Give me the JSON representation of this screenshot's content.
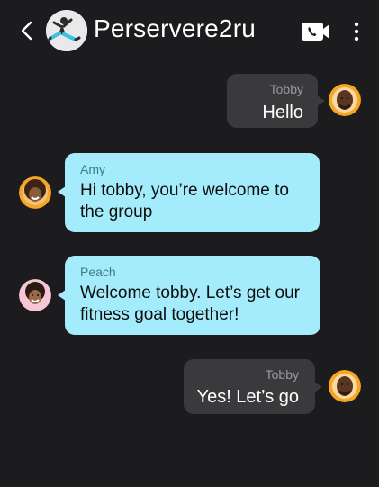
{
  "header": {
    "title": "Perservere2ru",
    "back_icon": "chevron-left-icon",
    "video_icon": "video-call-icon",
    "more_icon": "more-vertical-icon"
  },
  "messages": [
    {
      "direction": "outgoing",
      "sender": "Tobby",
      "text": "Hello"
    },
    {
      "direction": "incoming",
      "sender": "Amy",
      "text": "Hi tobby, you’re welcome to the group"
    },
    {
      "direction": "incoming",
      "sender": "Peach",
      "text": "Welcome tobby. Let’s get our fitness goal together!"
    },
    {
      "direction": "outgoing",
      "sender": "Tobby",
      "text": "Yes! Let’s go"
    }
  ],
  "colors": {
    "background": "#1c1c1e",
    "outgoing_bubble": "#3a3a3c",
    "incoming_bubble": "#a4ecfb",
    "avatar_ring_orange": "#f5a623",
    "avatar_ring_pink": "#f6c6d6"
  }
}
